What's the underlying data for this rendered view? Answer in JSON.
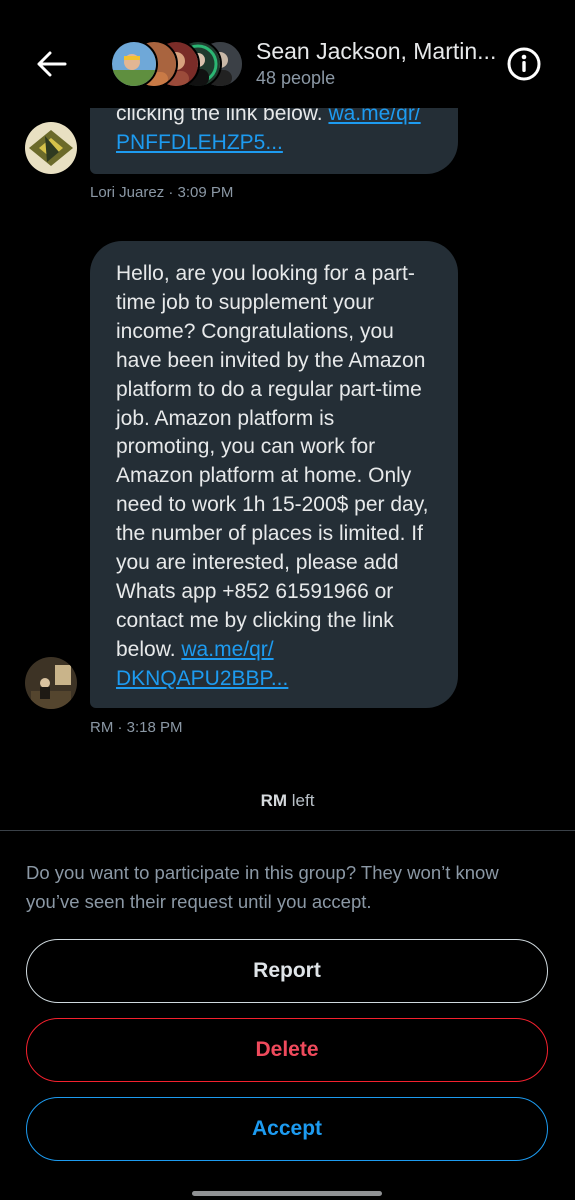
{
  "header": {
    "title": "Sean Jackson, Martin...",
    "subtitle": "48 people",
    "back_icon": "arrow-left-icon",
    "info_icon": "info-circle-icon"
  },
  "messages": [
    {
      "text_lines": "clicking the link below. ",
      "link_line1": "wa.me/qr/",
      "link_line2": "PNFFDLEHZP5...",
      "meta": "Lori Juarez · 3:09 PM"
    },
    {
      "text": "Hello, are you looking for a part-time job to supplement your income? Congratulations, you have been invited by the Amazon platform to do a regular part-time job. Amazon platform is promoting, you can work for Amazon platform at home. Only need to work 1h 15-200$ per day, the number of places is limited. If you are interested, please add Whats app +852 61591966 or contact me by clicking the link below. ",
      "link_line1": "wa.me/qr/",
      "link_line2": "DKNQAPU2BBP...",
      "meta": "RM · 3:18 PM"
    }
  ],
  "system": {
    "name": "RM",
    "action": " left"
  },
  "request": {
    "prompt": "Do you want to participate in this group? They won’t know you’ve seen their request until you accept.",
    "report_label": "Report",
    "delete_label": "Delete",
    "accept_label": "Accept"
  },
  "colors": {
    "background": "#000000",
    "bubble": "#242e36",
    "link": "#1d9bf0",
    "delete": "#f4212e",
    "accept": "#1d9bf0",
    "muted": "#8b98a5"
  }
}
